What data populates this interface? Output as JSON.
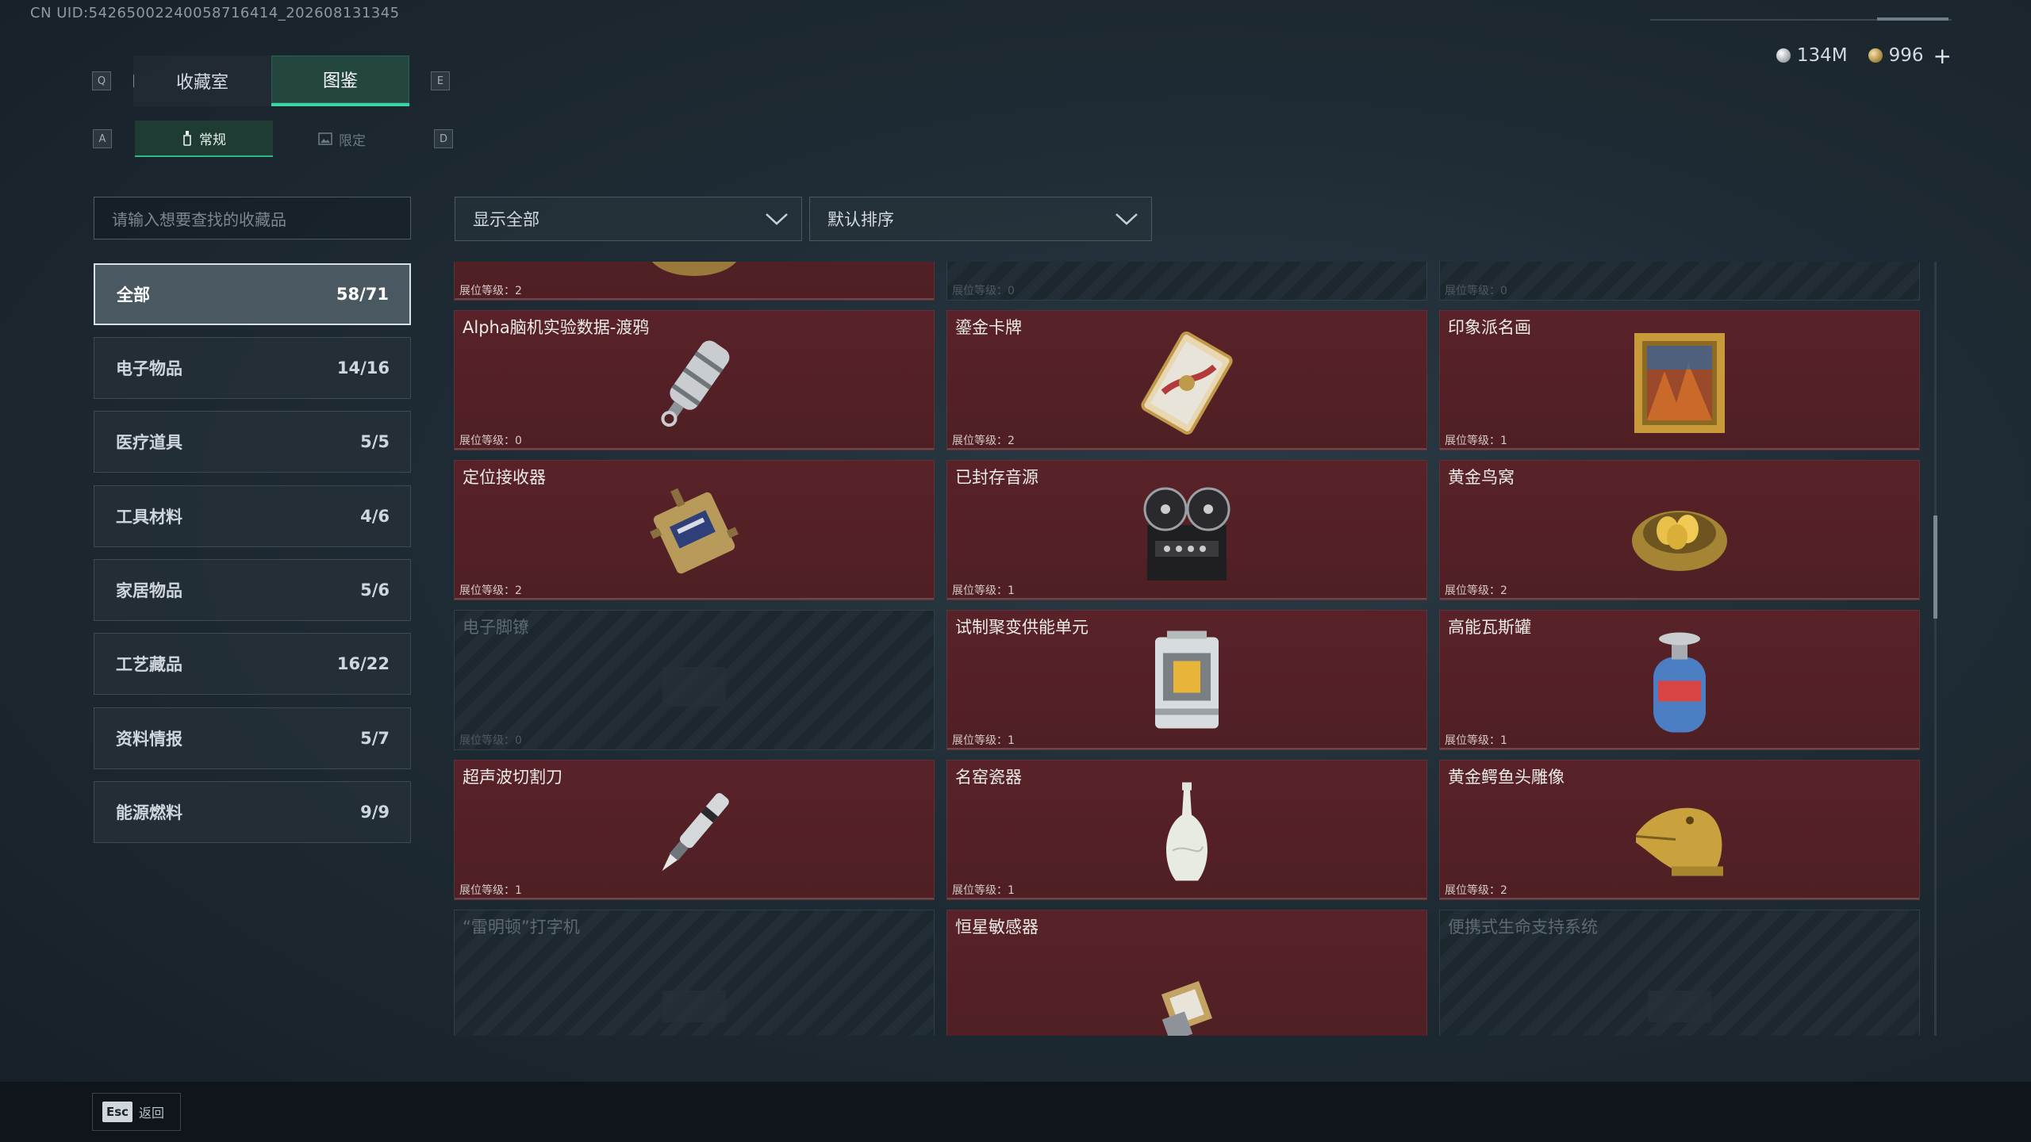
{
  "uid_text": "CN UID:542650022400587164­14_202608131345",
  "currency": {
    "silver": "134M",
    "gold": "996",
    "add": "+"
  },
  "keys": {
    "prev_tab": "Q",
    "next_tab": "E",
    "prev_sub": "A",
    "next_sub": "D"
  },
  "tabs": [
    "收藏室",
    "图鉴"
  ],
  "subtabs": [
    "常规",
    "限定"
  ],
  "search": {
    "placeholder": "请输入想要查找的收藏品"
  },
  "filters": {
    "show": "显示全部",
    "sort": "默认排序"
  },
  "categories": [
    {
      "label": "全部",
      "count": "58/71"
    },
    {
      "label": "电子物品",
      "count": "14/16"
    },
    {
      "label": "医疗道具",
      "count": "5/5"
    },
    {
      "label": "工具材料",
      "count": "4/6"
    },
    {
      "label": "家居物品",
      "count": "5/6"
    },
    {
      "label": "工艺藏品",
      "count": "16/22"
    },
    {
      "label": "资料情报",
      "count": "5/7"
    },
    {
      "label": "能源燃料",
      "count": "9/9"
    }
  ],
  "items": [
    {
      "name": "",
      "level": "展位等级：2",
      "icon": "caviar-tin-icon",
      "locked": false
    },
    {
      "name": "",
      "level": "展位等级：0",
      "icon": "locked-item-icon",
      "locked": true
    },
    {
      "name": "",
      "level": "展位等级：0",
      "icon": "locked-item-icon",
      "locked": true
    },
    {
      "name": "Alpha脑机实验数据-渡鸦",
      "level": "展位等级：0",
      "icon": "data-capsule-icon",
      "locked": false
    },
    {
      "name": "鎏金卡牌",
      "level": "展位等级：2",
      "icon": "gilded-card-icon",
      "locked": false
    },
    {
      "name": "印象派名画",
      "level": "展位等级：1",
      "icon": "framed-painting-icon",
      "locked": false
    },
    {
      "name": "定位接收器",
      "level": "展位等级：2",
      "icon": "receiver-device-icon",
      "locked": false
    },
    {
      "name": "已封存音源",
      "level": "展位等级：1",
      "icon": "reel-tape-recorder-icon",
      "locked": false
    },
    {
      "name": "黄金鸟窝",
      "level": "展位等级：2",
      "icon": "golden-nest-icon",
      "locked": false
    },
    {
      "name": "电子脚镣",
      "level": "展位等级：0",
      "icon": "locked-item-icon",
      "locked": true
    },
    {
      "name": "试制聚变供能单元",
      "level": "展位等级：1",
      "icon": "fusion-power-unit-icon",
      "locked": false
    },
    {
      "name": "高能瓦斯罐",
      "level": "展位等级：1",
      "icon": "gas-canister-icon",
      "locked": false
    },
    {
      "name": "超声波切割刀",
      "level": "展位等级：1",
      "icon": "ultrasonic-knife-icon",
      "locked": false
    },
    {
      "name": "名窑瓷器",
      "level": "展位等级：1",
      "icon": "porcelain-vase-icon",
      "locked": false
    },
    {
      "name": "黄金鳄鱼头雕像",
      "level": "展位等级：2",
      "icon": "golden-crocodile-icon",
      "locked": false
    },
    {
      "name": "“雷明顿”打字机",
      "level": "",
      "icon": "locked-item-icon",
      "locked": true
    },
    {
      "name": "恒星敏感器",
      "level": "",
      "icon": "star-sensor-icon",
      "locked": false
    },
    {
      "name": "便携式生命支持系统",
      "level": "",
      "icon": "locked-item-icon",
      "locked": true
    }
  ],
  "footer": {
    "esc": "Esc",
    "back": "返回"
  }
}
